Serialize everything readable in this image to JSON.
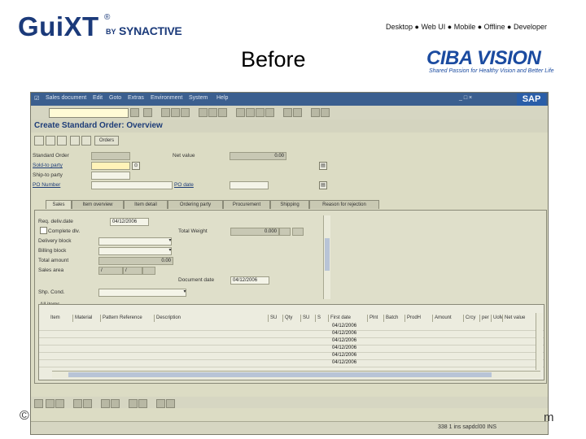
{
  "slide": {
    "logo": {
      "gui": "GuiXT",
      "reg": "®",
      "by": "BY",
      "company": "SYNACTIVE"
    },
    "nav": "Desktop ● Web UI ● Mobile ● Offline ● Developer",
    "title": "Before",
    "client_logo": {
      "name": "CIBA VISION",
      "tagline": "Shared Passion for Healthy Vision and Better Life"
    },
    "footer_left": "©",
    "footer_right": "m"
  },
  "sap": {
    "menu": [
      "Sales document",
      "Edit",
      "Goto",
      "Extras",
      "Environment",
      "System",
      "Help"
    ],
    "window_controls": "_ □ ×",
    "brand": "SAP",
    "screen_title": "Create Standard Order: Overview",
    "orders_button": "Orders",
    "header": {
      "standard_order_label": "Standard Order",
      "net_value_label": "Net value",
      "net_value": "0.00",
      "sold_to_label": "Sold-to party",
      "ship_to_label": "Ship-to party",
      "po_number_label": "PO Number",
      "po_date_label": "PO date"
    },
    "tabs": [
      "Sales",
      "Item overview",
      "Item detail",
      "Ordering party",
      "Procurement",
      "Shipping",
      "Reason for rejection"
    ],
    "sales": {
      "req_deliv_date_label": "Req. deliv.date",
      "req_deliv_date": "04/12/2006",
      "complete_dlv_label": "Complete dlv.",
      "total_weight_label": "Total Weight",
      "total_weight": "0.000",
      "delivery_block_label": "Delivery block",
      "billing_block_label": "Billing block",
      "total_amount_label": "Total amount",
      "total_amount": "0.00",
      "sales_area_label": "Sales area",
      "sales_area_1": "/",
      "sales_area_2": "/",
      "document_date_label": "Document date",
      "document_date": "04/12/2006",
      "shipping_cond_label": "Shp. Cond."
    },
    "items_title": "All items",
    "columns": [
      "Item",
      "Material",
      "Pattern Reference",
      "Description",
      "SU",
      "Qty",
      "SU",
      "S",
      "First date",
      "Plnt",
      "Batch",
      "ProdH",
      "Amount",
      "Crcy",
      "per",
      "UoM",
      "Net value"
    ],
    "item_dates": [
      "04/12/2006",
      "04/12/2006",
      "04/12/2006",
      "04/12/2006",
      "04/12/2006",
      "04/12/2006"
    ],
    "status": "338 1 ins   sapdcl00 INS"
  }
}
